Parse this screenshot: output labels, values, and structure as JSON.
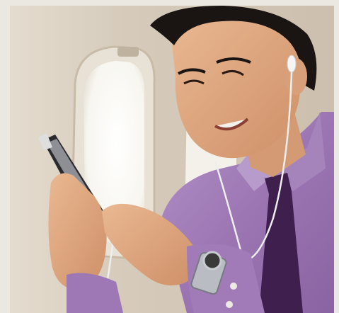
{
  "image": {
    "subject": "man-listening-to-music-on-airplane",
    "colors": {
      "frame": "#ebe8e2",
      "cabin_wall": "#d8cdbf",
      "window_light": "#fbfbf7",
      "shirt": "#a17bb8",
      "tie": "#3e1f4e",
      "skin": "#dda37e",
      "hair": "#1a1412"
    }
  }
}
